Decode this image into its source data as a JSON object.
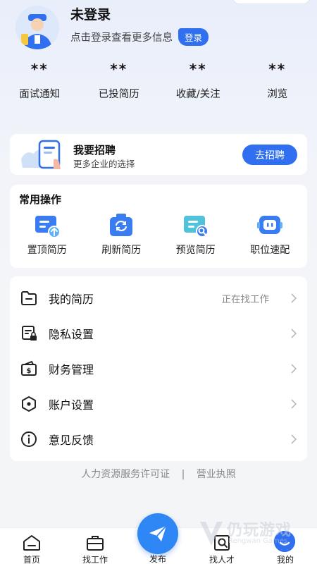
{
  "profile": {
    "name": "未登录",
    "subtitle": "点击登录查看更多信息",
    "login_label": "登录"
  },
  "stats": [
    {
      "value": "**",
      "label": "面试通知"
    },
    {
      "value": "**",
      "label": "已投简历"
    },
    {
      "value": "**",
      "label": "收藏/关注"
    },
    {
      "value": "**",
      "label": "浏览"
    }
  ],
  "recruit": {
    "title": "我要招聘",
    "subtitle": "更多企业的选择",
    "button": "去招聘"
  },
  "ops": {
    "title": "常用操作",
    "items": [
      {
        "label": "置顶简历",
        "icon": "top-resume-icon"
      },
      {
        "label": "刷新简历",
        "icon": "refresh-resume-icon"
      },
      {
        "label": "预览简历",
        "icon": "preview-resume-icon"
      },
      {
        "label": "职位速配",
        "icon": "job-match-icon"
      }
    ]
  },
  "menu": [
    {
      "label": "我的简历",
      "status": "正在找工作",
      "icon": "folder-icon"
    },
    {
      "label": "隐私设置",
      "status": "",
      "icon": "privacy-lock-icon"
    },
    {
      "label": "财务管理",
      "status": "",
      "icon": "wallet-icon"
    },
    {
      "label": "账户设置",
      "status": "",
      "icon": "settings-hexagon-icon"
    },
    {
      "label": "意见反馈",
      "status": "",
      "icon": "info-icon"
    }
  ],
  "footer": {
    "license": "人力资源服务许可证",
    "separator": "|",
    "business": "营业执照"
  },
  "nav": {
    "home": "首页",
    "find_job": "找工作",
    "publish": "发布",
    "find_talent": "找人才",
    "me": "我的"
  },
  "watermark": {
    "text": "仍玩游戏",
    "sub": "Rengwan Games"
  },
  "colors": {
    "accent": "#2f6ff0",
    "publish": "#2f86f5",
    "text": "#222222",
    "muted": "#888888"
  }
}
